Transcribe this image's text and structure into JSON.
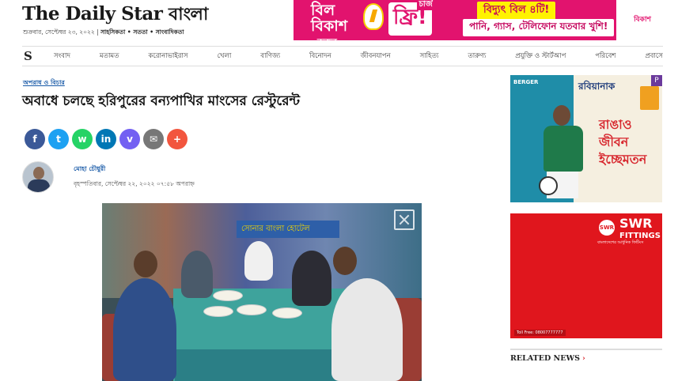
{
  "masthead": {
    "logo_en": "The Daily Star",
    "logo_bn": "বাংলা",
    "date": "শুক্রবার, সেপ্টেম্বর ২৩, ২০২২ |",
    "tags": "সাহসিকতা • সততা • সাংবাদিকতা"
  },
  "top_ad": {
    "bill_line1": "বিল",
    "bill_line2": "বিকাশ",
    "bill_line3": "করুন",
    "charge": "চার্জ",
    "free": "ফ্রি!",
    "box1": "বিদ্যুৎ বিল ৪টি!",
    "box2": "পানি, গ্যাস, টেলিফোন যতবার খুশি!",
    "brand": "বিকাশ"
  },
  "nav": {
    "logo_icon": "S",
    "items": [
      "সংবাদ",
      "মতামত",
      "করোনাভাইরাস",
      "খেলা",
      "বাণিজ্য",
      "বিনোদন",
      "জীবনযাপন",
      "সাহিত্য",
      "তারুণ্য",
      "প্রযুক্তি ও স্টার্টআপ",
      "পরিবেশ",
      "প্রবাসে"
    ]
  },
  "article": {
    "category": "অপরাধ ও বিচার",
    "headline": "অবাধে চলছে হরিপুরের বন্যপাখির মাংসের রেস্টুরেন্ট",
    "author": "মোহা চৌধুরী",
    "published": "বৃহস্পতিবার, সেপ্টেম্বর ২২, ২০২২ ০৭:৫৮ অপরাহ্ন",
    "photo_sign": "সোনার বাংলা হোটেল"
  },
  "share": [
    {
      "name": "facebook",
      "glyph": "f",
      "color": "#3b5998"
    },
    {
      "name": "twitter",
      "glyph": "t",
      "color": "#1da1f2"
    },
    {
      "name": "whatsapp",
      "glyph": "w",
      "color": "#25d366"
    },
    {
      "name": "linkedin",
      "glyph": "in",
      "color": "#0077b5"
    },
    {
      "name": "viber",
      "glyph": "v",
      "color": "#7360f2"
    },
    {
      "name": "email",
      "glyph": "✉",
      "color": "#777777"
    },
    {
      "name": "more",
      "glyph": "+",
      "color": "#f2553e"
    }
  ],
  "sidebar": {
    "ad1_corner": "BERGER",
    "ad1_brand": "রবিয়ানাক",
    "ad1_slogan": "রাঙাও জীবন ইচ্ছেমতন",
    "ad1_badge": "P",
    "ad2_logo": "SWR",
    "ad2_brand": "SWR",
    "ad2_sub": "FITTINGS",
    "ad2_tagline": "বাংলাদেশের আধুনিক ফিটিংস",
    "ad2_tollfree": "Toll Free: 08007777777",
    "related_label": "RELATED NEWS",
    "related_chevron": "›"
  }
}
